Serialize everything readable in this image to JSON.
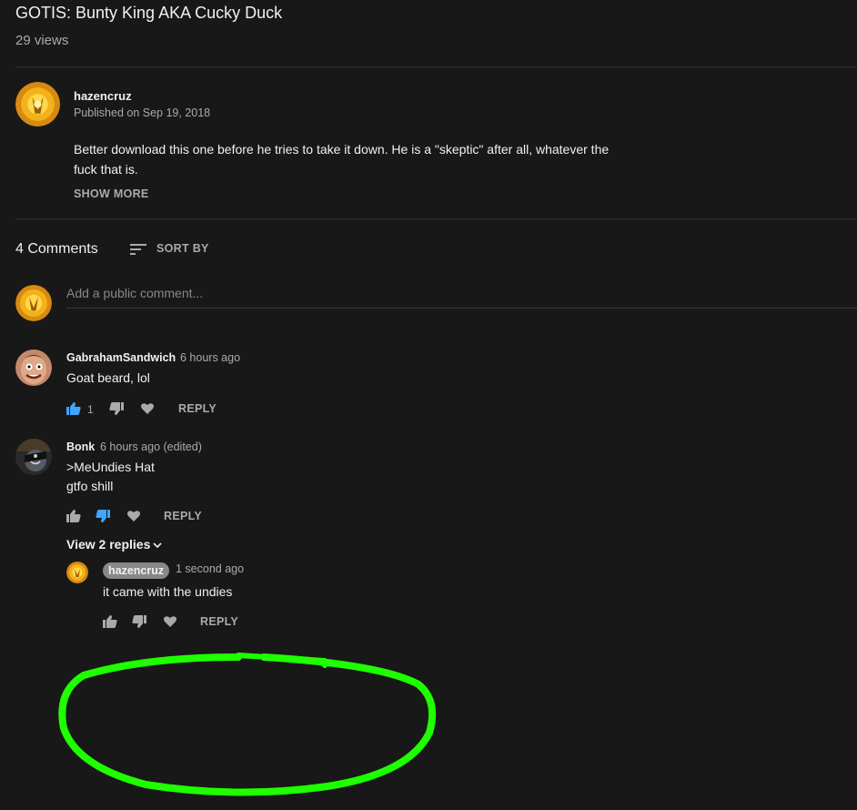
{
  "video": {
    "title": "GOTIS: Bunty King AKA Cucky Duck",
    "views": "29 views"
  },
  "owner": {
    "name": "hazencruz",
    "published": "Published on Sep 19, 2018",
    "description": "Better download this one before he tries to take it down. He is a \"skeptic\" after all, whatever the fuck that is.",
    "show_more": "SHOW MORE"
  },
  "comments_header": {
    "count_label": "4 Comments",
    "sort_label": "SORT BY",
    "placeholder": "Add a public comment..."
  },
  "comments": [
    {
      "author": "GabrahamSandwich",
      "time": "6 hours ago",
      "text": "Goat beard, lol",
      "likes": "1",
      "liked": true,
      "disliked": false,
      "reply_label": "REPLY"
    },
    {
      "author": "Bonk",
      "time": "6 hours ago (edited)",
      "text_line1": ">MeUndies Hat",
      "text_line2": "gtfo shill",
      "liked": false,
      "disliked": true,
      "reply_label": "REPLY",
      "view_replies": "View 2 replies"
    }
  ],
  "reply": {
    "author": "hazencruz",
    "time": "1 second ago",
    "text": "it came with the undies",
    "reply_label": "REPLY"
  },
  "colors": {
    "background": "#181818",
    "liked_blue": "#3ea6ff",
    "annotation_green": "#1eff00"
  },
  "icons": [
    "sort-icon",
    "thumbs-up-icon",
    "thumbs-down-icon",
    "heart-icon",
    "chevron-down-icon"
  ]
}
